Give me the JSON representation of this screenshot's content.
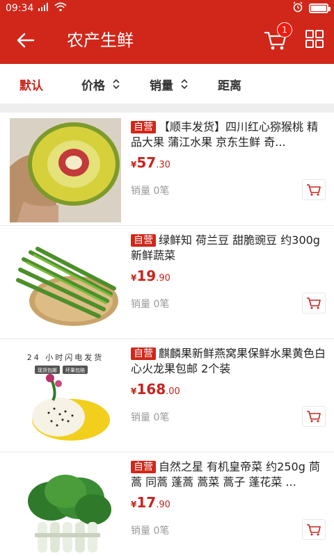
{
  "status_bar": {
    "time": "09:34"
  },
  "header": {
    "title": "农产生鲜",
    "cart_count": "1"
  },
  "sort_tabs": [
    {
      "label": "默认",
      "active": true
    },
    {
      "label": "价格",
      "active": false
    },
    {
      "label": "销量",
      "active": false
    },
    {
      "label": "距离",
      "active": false
    }
  ],
  "products": [
    {
      "tag": "自营",
      "title": "【顺丰发货】四川红心猕猴桃 精品大果 蒲江水果 京东生鲜 奇...",
      "price_symbol": "¥",
      "price_int": "57",
      "price_dec": ".30",
      "sales": "销量 0笔"
    },
    {
      "tag": "自营",
      "title": "绿鲜知 荷兰豆 甜脆豌豆 约300g 新鲜蔬菜",
      "price_symbol": "¥",
      "price_int": "19",
      "price_dec": ".90",
      "sales": "销量 0笔"
    },
    {
      "tag": "自营",
      "title": "麒麟果新鲜燕窝果保鲜水果黄色白心火龙果包邮 2个装",
      "price_symbol": "¥",
      "price_int": "168",
      "price_dec": ".00",
      "sales": "销量 0笔",
      "image_caption": "24 小时闪电发货",
      "image_badges": [
        "现货包邮",
        "坏果包赔"
      ]
    },
    {
      "tag": "自营",
      "title": "自然之星 有机皇帝菜 约250g 茼蒿 同蒿 蓬蒿 蒿菜 蒿子 蓬花菜 ...",
      "price_symbol": "¥",
      "price_int": "17",
      "price_dec": ".90",
      "sales": "销量 0笔"
    }
  ]
}
